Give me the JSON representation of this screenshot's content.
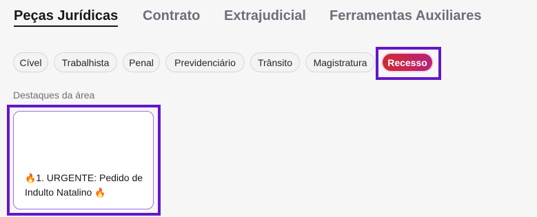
{
  "tabs": [
    {
      "label": "Peças Jurídicas",
      "active": true
    },
    {
      "label": "Contrato",
      "active": false
    },
    {
      "label": "Extrajudicial",
      "active": false
    },
    {
      "label": "Ferramentas Auxiliares",
      "active": false
    }
  ],
  "chips": [
    {
      "label": "Cível"
    },
    {
      "label": "Trabalhista"
    },
    {
      "label": "Penal"
    },
    {
      "label": "Previdenciário"
    },
    {
      "label": "Trânsito"
    },
    {
      "label": "Magistratura"
    },
    {
      "label": "Recesso",
      "selected": true
    }
  ],
  "section": {
    "label": "Destaques da área"
  },
  "cards": [
    {
      "title": "1. URGENTE: Pedido de Indulto Natalino",
      "icon": "flame-icon"
    }
  ],
  "colors": {
    "highlight": "#6417c9",
    "recesso_gradient_start": "#d12a33",
    "recesso_gradient_end": "#b7227a",
    "card_border": "#a56fdc"
  }
}
